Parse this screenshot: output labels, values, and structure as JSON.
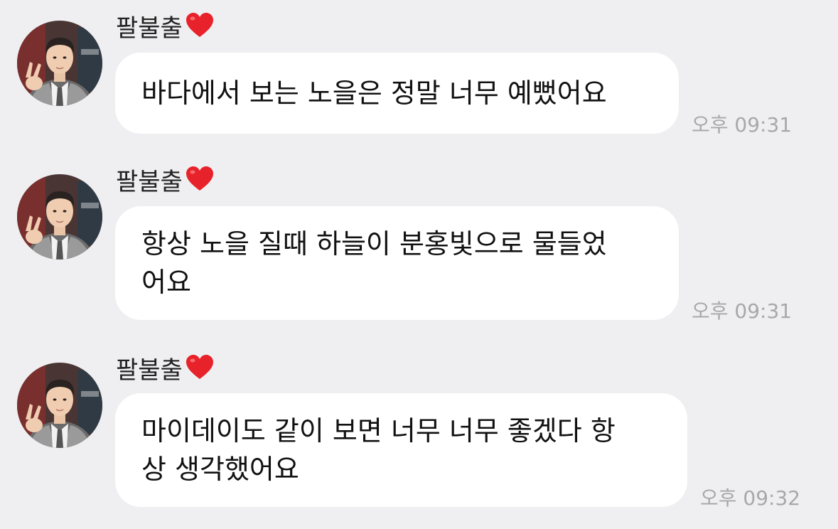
{
  "messages": [
    {
      "sender": "팔불출",
      "text": "바다에서 보는 노을은 정말 너무 예뻤어요",
      "time": "오후 09:31"
    },
    {
      "sender": "팔불출",
      "text": "항상 노을 질때 하늘이 분홍빛으로 물들었\n어요",
      "time": "오후 09:31"
    },
    {
      "sender": "팔불출",
      "text": "마이데이도 같이 보면 너무 너무 좋겠다 항\n상 생각했어요",
      "time": "오후 09:32"
    }
  ]
}
